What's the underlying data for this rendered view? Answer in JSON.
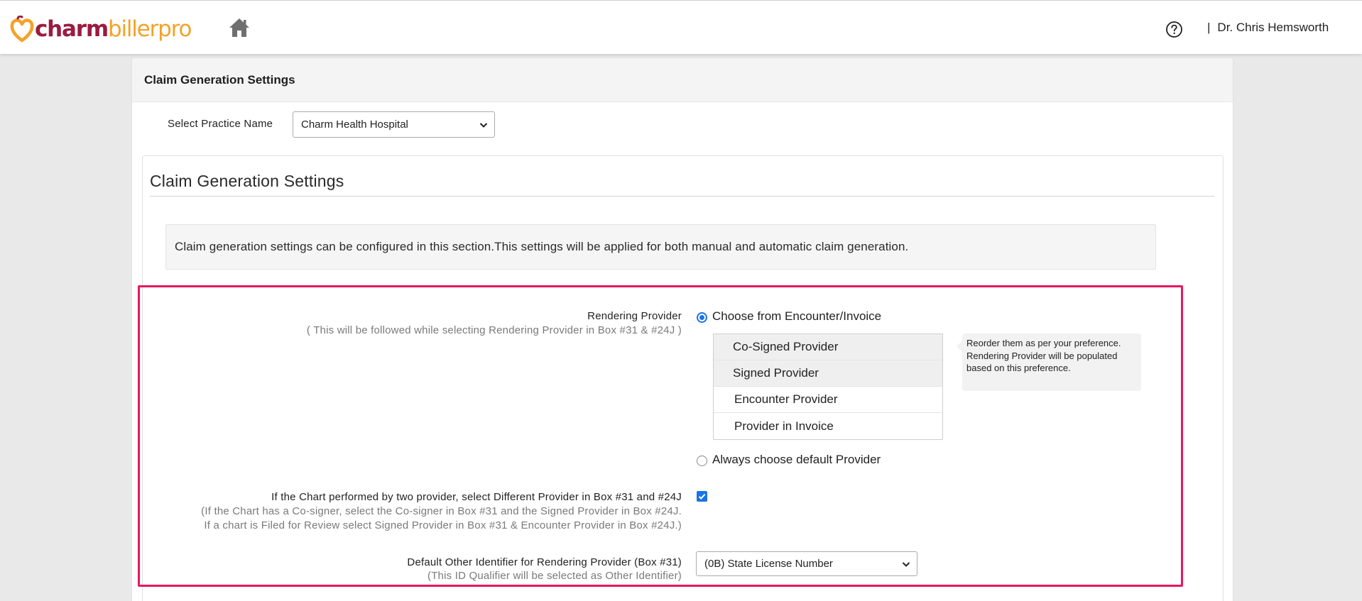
{
  "header": {
    "logo_charm": "charm",
    "logo_rest": "billerpro",
    "user_separator": "|",
    "user_name": "Dr. Chris Hemsworth"
  },
  "icons": {
    "logo": "heart-logo-icon",
    "home": "home-icon",
    "help": "help-circle-icon",
    "dropdown": "chevron-down-icon",
    "check": "check-icon"
  },
  "panel": {
    "title": "Claim Generation Settings",
    "practice_label": "Select Practice Name",
    "practice_value": "Charm Health Hospital",
    "section_title": "Claim Generation Settings",
    "info_text": "Claim generation settings can be configured in this section.This settings will be applied for both manual and automatic claim generation."
  },
  "rendering_provider": {
    "label": "Rendering Provider",
    "sublabel": "( This will be followed while selecting Rendering Provider in Box #31 & #24J )",
    "option_encounter": "Choose from Encounter/Invoice",
    "option_encounter_selected": true,
    "order_items": [
      "Co-Signed Provider",
      "Signed Provider",
      "Encounter Provider",
      "Provider in Invoice"
    ],
    "tooltip": "Reorder them as per your preference. Rendering Provider will be populated based on this preference.",
    "option_default": "Always choose default Provider",
    "option_default_selected": false
  },
  "two_provider": {
    "label": "If the Chart performed by two provider, select Different Provider in Box #31 and #24J",
    "sub_line1": "(If the Chart has a Co-signer, select the Co-signer in Box #31 and the Signed Provider in Box #24J.",
    "sub_line2": "If a chart is Filed for Review select Signed Provider in Box #31 & Encounter Provider in Box #24J.)",
    "checked": true
  },
  "other_identifier": {
    "label": "Default Other Identifier for Rendering Provider (Box #31)",
    "sublabel": "(This ID Qualifier will be selected as Other Identifier)",
    "value": "(0B) State License Number"
  },
  "colors": {
    "brand_primary": "#9b1b40",
    "brand_secondary": "#f4a228",
    "highlight_border": "#e8175d",
    "accent_blue": "#1a73e8"
  }
}
